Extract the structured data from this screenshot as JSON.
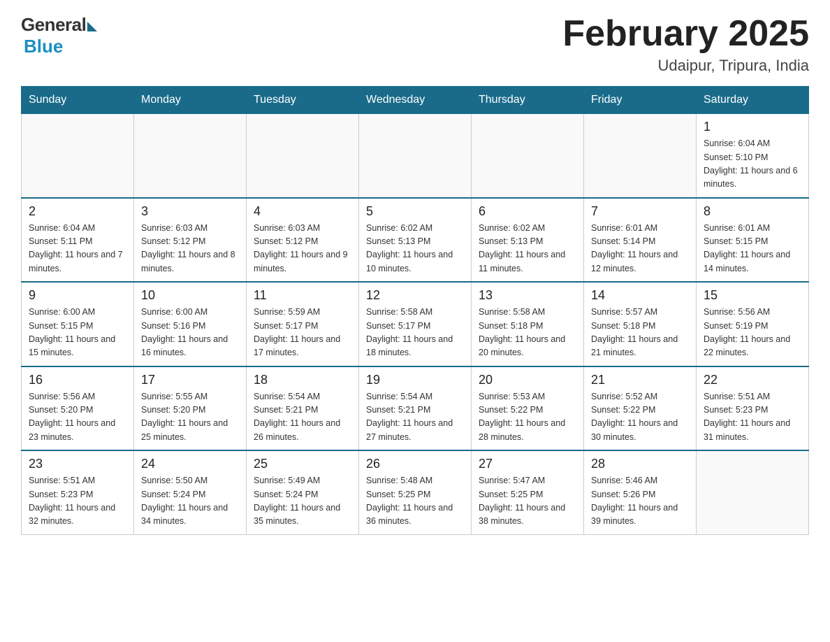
{
  "header": {
    "logo_general": "General",
    "logo_blue": "Blue",
    "month_title": "February 2025",
    "subtitle": "Udaipur, Tripura, India"
  },
  "days_of_week": [
    "Sunday",
    "Monday",
    "Tuesday",
    "Wednesday",
    "Thursday",
    "Friday",
    "Saturday"
  ],
  "weeks": [
    [
      {
        "day": "",
        "info": ""
      },
      {
        "day": "",
        "info": ""
      },
      {
        "day": "",
        "info": ""
      },
      {
        "day": "",
        "info": ""
      },
      {
        "day": "",
        "info": ""
      },
      {
        "day": "",
        "info": ""
      },
      {
        "day": "1",
        "info": "Sunrise: 6:04 AM\nSunset: 5:10 PM\nDaylight: 11 hours and 6 minutes."
      }
    ],
    [
      {
        "day": "2",
        "info": "Sunrise: 6:04 AM\nSunset: 5:11 PM\nDaylight: 11 hours and 7 minutes."
      },
      {
        "day": "3",
        "info": "Sunrise: 6:03 AM\nSunset: 5:12 PM\nDaylight: 11 hours and 8 minutes."
      },
      {
        "day": "4",
        "info": "Sunrise: 6:03 AM\nSunset: 5:12 PM\nDaylight: 11 hours and 9 minutes."
      },
      {
        "day": "5",
        "info": "Sunrise: 6:02 AM\nSunset: 5:13 PM\nDaylight: 11 hours and 10 minutes."
      },
      {
        "day": "6",
        "info": "Sunrise: 6:02 AM\nSunset: 5:13 PM\nDaylight: 11 hours and 11 minutes."
      },
      {
        "day": "7",
        "info": "Sunrise: 6:01 AM\nSunset: 5:14 PM\nDaylight: 11 hours and 12 minutes."
      },
      {
        "day": "8",
        "info": "Sunrise: 6:01 AM\nSunset: 5:15 PM\nDaylight: 11 hours and 14 minutes."
      }
    ],
    [
      {
        "day": "9",
        "info": "Sunrise: 6:00 AM\nSunset: 5:15 PM\nDaylight: 11 hours and 15 minutes."
      },
      {
        "day": "10",
        "info": "Sunrise: 6:00 AM\nSunset: 5:16 PM\nDaylight: 11 hours and 16 minutes."
      },
      {
        "day": "11",
        "info": "Sunrise: 5:59 AM\nSunset: 5:17 PM\nDaylight: 11 hours and 17 minutes."
      },
      {
        "day": "12",
        "info": "Sunrise: 5:58 AM\nSunset: 5:17 PM\nDaylight: 11 hours and 18 minutes."
      },
      {
        "day": "13",
        "info": "Sunrise: 5:58 AM\nSunset: 5:18 PM\nDaylight: 11 hours and 20 minutes."
      },
      {
        "day": "14",
        "info": "Sunrise: 5:57 AM\nSunset: 5:18 PM\nDaylight: 11 hours and 21 minutes."
      },
      {
        "day": "15",
        "info": "Sunrise: 5:56 AM\nSunset: 5:19 PM\nDaylight: 11 hours and 22 minutes."
      }
    ],
    [
      {
        "day": "16",
        "info": "Sunrise: 5:56 AM\nSunset: 5:20 PM\nDaylight: 11 hours and 23 minutes."
      },
      {
        "day": "17",
        "info": "Sunrise: 5:55 AM\nSunset: 5:20 PM\nDaylight: 11 hours and 25 minutes."
      },
      {
        "day": "18",
        "info": "Sunrise: 5:54 AM\nSunset: 5:21 PM\nDaylight: 11 hours and 26 minutes."
      },
      {
        "day": "19",
        "info": "Sunrise: 5:54 AM\nSunset: 5:21 PM\nDaylight: 11 hours and 27 minutes."
      },
      {
        "day": "20",
        "info": "Sunrise: 5:53 AM\nSunset: 5:22 PM\nDaylight: 11 hours and 28 minutes."
      },
      {
        "day": "21",
        "info": "Sunrise: 5:52 AM\nSunset: 5:22 PM\nDaylight: 11 hours and 30 minutes."
      },
      {
        "day": "22",
        "info": "Sunrise: 5:51 AM\nSunset: 5:23 PM\nDaylight: 11 hours and 31 minutes."
      }
    ],
    [
      {
        "day": "23",
        "info": "Sunrise: 5:51 AM\nSunset: 5:23 PM\nDaylight: 11 hours and 32 minutes."
      },
      {
        "day": "24",
        "info": "Sunrise: 5:50 AM\nSunset: 5:24 PM\nDaylight: 11 hours and 34 minutes."
      },
      {
        "day": "25",
        "info": "Sunrise: 5:49 AM\nSunset: 5:24 PM\nDaylight: 11 hours and 35 minutes."
      },
      {
        "day": "26",
        "info": "Sunrise: 5:48 AM\nSunset: 5:25 PM\nDaylight: 11 hours and 36 minutes."
      },
      {
        "day": "27",
        "info": "Sunrise: 5:47 AM\nSunset: 5:25 PM\nDaylight: 11 hours and 38 minutes."
      },
      {
        "day": "28",
        "info": "Sunrise: 5:46 AM\nSunset: 5:26 PM\nDaylight: 11 hours and 39 minutes."
      },
      {
        "day": "",
        "info": ""
      }
    ]
  ]
}
